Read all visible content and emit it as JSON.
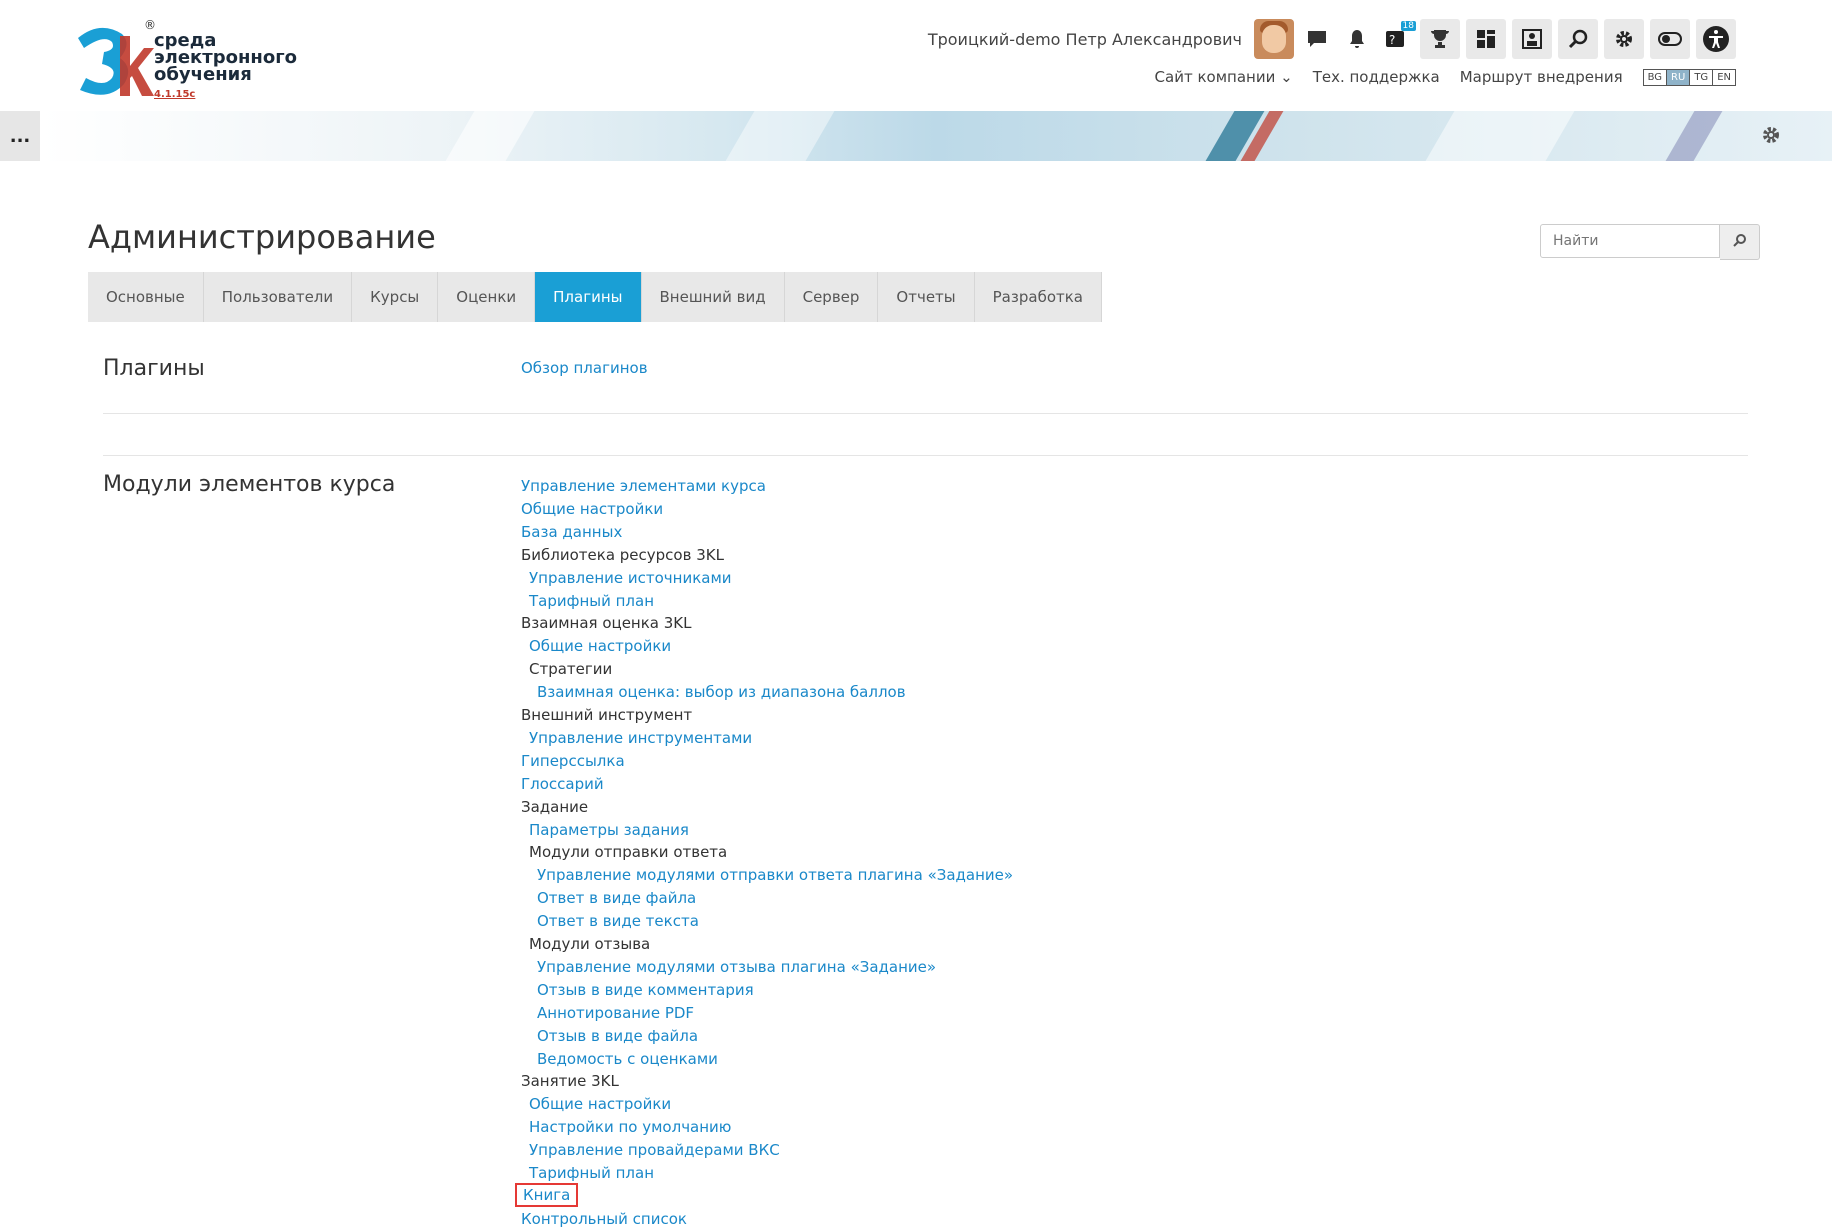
{
  "logo": {
    "reg": "®",
    "line1": "среда",
    "line2": "электронного",
    "line3": "обучения",
    "version": "4.1.15c"
  },
  "header": {
    "user_name": "Троицкий-demo Петр Александрович",
    "badge_count": "18",
    "nav": {
      "company_site": "Сайт компании",
      "support": "Тех. поддержка",
      "roadmap": "Маршрут внедрения"
    },
    "languages": [
      "BG",
      "RU",
      "TG",
      "EN"
    ],
    "active_language": "RU"
  },
  "menu_toggle": "...",
  "page": {
    "title": "Администрирование",
    "search_placeholder": "Найти"
  },
  "tabs": [
    "Основные",
    "Пользователи",
    "Курсы",
    "Оценки",
    "Плагины",
    "Внешний вид",
    "Сервер",
    "Отчеты",
    "Разработка"
  ],
  "active_tab": "Плагины",
  "sections": {
    "plugins": {
      "title": "Плагины",
      "links": [
        "Обзор плагинов"
      ]
    },
    "modules": {
      "title": "Модули элементов курса",
      "items": [
        {
          "text": "Управление элементами курса",
          "type": "link",
          "level": 0
        },
        {
          "text": "Общие настройки",
          "type": "link",
          "level": 0
        },
        {
          "text": "База данных",
          "type": "link",
          "level": 0
        },
        {
          "text": "Библиотека ресурсов 3KL",
          "type": "label",
          "level": 0
        },
        {
          "text": "Управление источниками",
          "type": "link",
          "level": 1
        },
        {
          "text": "Тарифный план",
          "type": "link",
          "level": 1
        },
        {
          "text": "Взаимная оценка 3KL",
          "type": "label",
          "level": 0
        },
        {
          "text": "Общие настройки",
          "type": "link",
          "level": 1
        },
        {
          "text": "Стратегии",
          "type": "label",
          "level": 1
        },
        {
          "text": "Взаимная оценка: выбор из диапазона баллов",
          "type": "link",
          "level": 2
        },
        {
          "text": "Внешний инструмент",
          "type": "label",
          "level": 0
        },
        {
          "text": "Управление инструментами",
          "type": "link",
          "level": 1
        },
        {
          "text": "Гиперссылка",
          "type": "link",
          "level": 0
        },
        {
          "text": "Глоссарий",
          "type": "link",
          "level": 0
        },
        {
          "text": "Задание",
          "type": "label",
          "level": 0
        },
        {
          "text": "Параметры задания",
          "type": "link",
          "level": 1
        },
        {
          "text": "Модули отправки ответа",
          "type": "label",
          "level": 1
        },
        {
          "text": "Управление модулями отправки ответа плагина «Задание»",
          "type": "link",
          "level": 2
        },
        {
          "text": "Ответ в виде файла",
          "type": "link",
          "level": 2
        },
        {
          "text": "Ответ в виде текста",
          "type": "link",
          "level": 2
        },
        {
          "text": "Модули отзыва",
          "type": "label",
          "level": 1
        },
        {
          "text": "Управление модулями отзыва плагина «Задание»",
          "type": "link",
          "level": 2
        },
        {
          "text": "Отзыв в виде комментария",
          "type": "link",
          "level": 2
        },
        {
          "text": "Аннотирование PDF",
          "type": "link",
          "level": 2
        },
        {
          "text": "Отзыв в виде файла",
          "type": "link",
          "level": 2
        },
        {
          "text": "Ведомость с оценками",
          "type": "link",
          "level": 2
        },
        {
          "text": "Занятие 3KL",
          "type": "label",
          "level": 0
        },
        {
          "text": "Общие настройки",
          "type": "link",
          "level": 1
        },
        {
          "text": "Настройки по умолчанию",
          "type": "link",
          "level": 1
        },
        {
          "text": "Управление провайдерами ВКС",
          "type": "link",
          "level": 1
        },
        {
          "text": "Тарифный план",
          "type": "link",
          "level": 1
        },
        {
          "text": "Книга",
          "type": "link",
          "level": 0,
          "highlighted": true
        },
        {
          "text": "Контрольный список",
          "type": "link",
          "level": 0
        }
      ]
    }
  },
  "colors": {
    "accent": "#1a9fd5",
    "link": "#1a88c9",
    "highlight_border": "#e53935"
  }
}
